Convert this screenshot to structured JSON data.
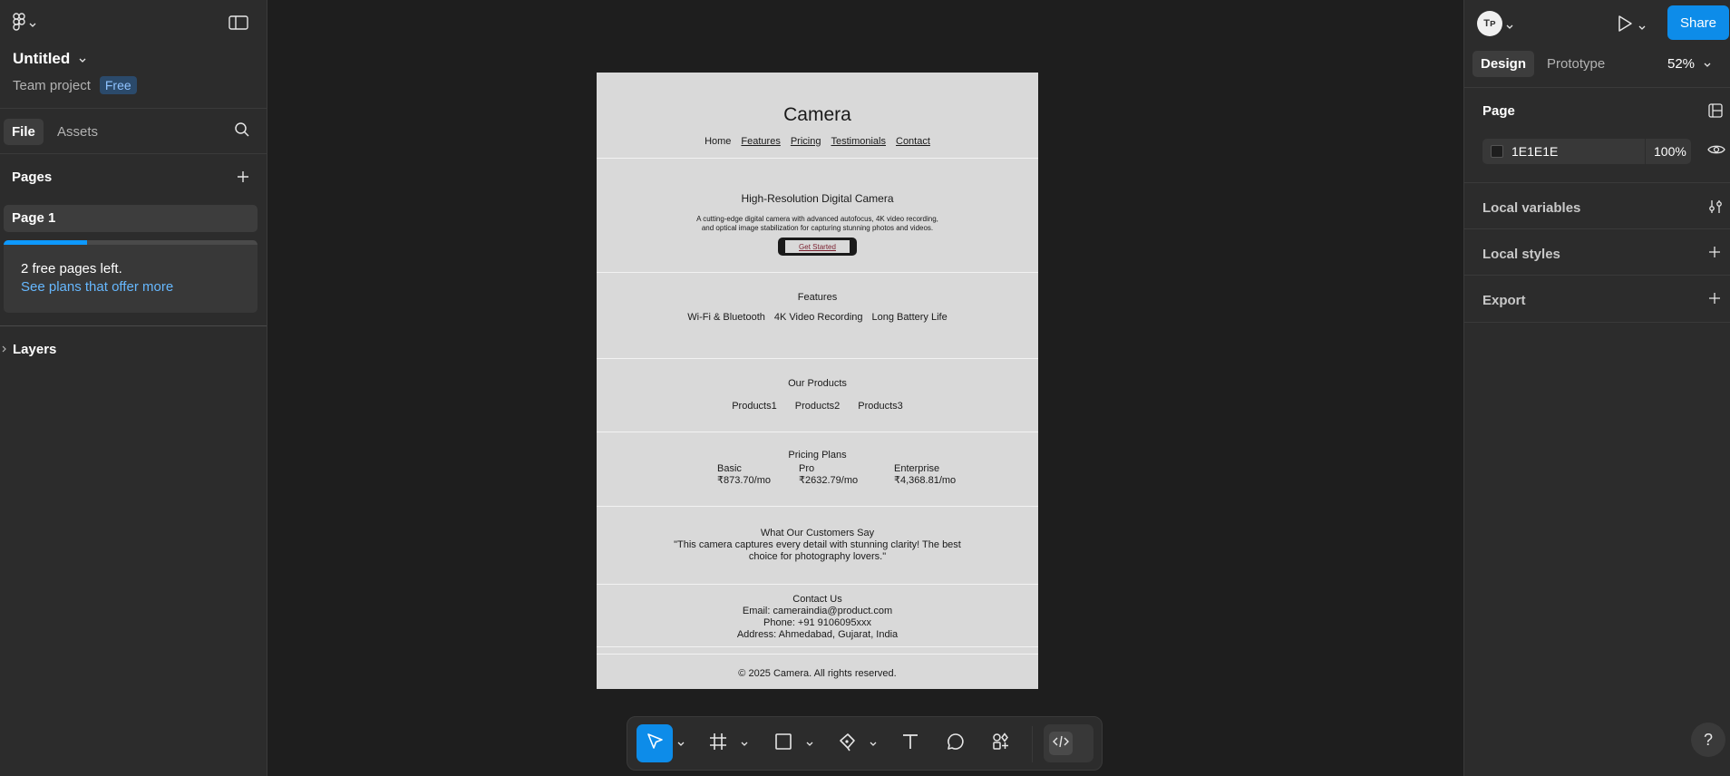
{
  "file": {
    "title": "Untitled",
    "team": "Team project",
    "plan_badge": "Free"
  },
  "left_tabs": {
    "file": "File",
    "assets": "Assets"
  },
  "pages": {
    "header": "Pages",
    "items": [
      "Page 1"
    ],
    "promo_text": "2 free pages left.",
    "promo_link": "See plans that offer more",
    "promo_progress": 0.33
  },
  "layers_header": "Layers",
  "right": {
    "avatar_initials": "Tᴘ",
    "share": "Share",
    "tabs": {
      "design": "Design",
      "prototype": "Prototype"
    },
    "zoom": "52%",
    "page_section": "Page",
    "bg_hex": "1E1E1E",
    "bg_opacity": "100",
    "percent": "%",
    "local_variables": "Local variables",
    "local_styles": "Local styles",
    "export": "Export",
    "help": "?"
  },
  "frame": {
    "title": "Camera",
    "nav": [
      "Home",
      "Features",
      "Pricing",
      "Testimonials",
      "Contact"
    ],
    "hero_title": "High-Resolution Digital Camera",
    "hero_desc_1": "A cutting-edge digital camera with advanced autofocus, 4K video recording,",
    "hero_desc_2": "and optical image stabilization for capturing stunning photos and videos.",
    "cta": "Get Started",
    "features_title": "Features",
    "features": [
      "Wi-Fi & Bluetooth",
      "4K Video Recording",
      "Long Battery Life"
    ],
    "products_title": "Our Products",
    "products": [
      "Products1",
      "Products2",
      "Products3"
    ],
    "pricing_title": "Pricing Plans",
    "plans": [
      {
        "name": "Basic",
        "price": "₹873.70/mo"
      },
      {
        "name": "Pro",
        "price": "₹2632.79/mo"
      },
      {
        "name": "Enterprise",
        "price": "₹4,368.81/mo"
      }
    ],
    "testimonials_title": "What Our Customers Say",
    "quote_1": "\"This camera captures every detail with stunning clarity! The best",
    "quote_2": "choice for photography lovers.\"",
    "contact_title": "Contact Us",
    "email": "Email: cameraindia@product.com",
    "phone": "Phone: +91 9106095xxx",
    "address": "Address: Ahmedabad, Gujarat, India",
    "footer": "© 2025 Camera. All rights reserved."
  },
  "colors": {
    "accent": "#0d99ff",
    "canvas": "#1e1e1e",
    "panel": "#2c2c2c",
    "frame_bg": "#d9d9d9"
  },
  "toolbar_icons": [
    "move-icon",
    "frame-icon",
    "rectangle-icon",
    "pen-icon",
    "text-icon",
    "comment-icon",
    "actions-icon",
    "dev-mode-icon"
  ]
}
